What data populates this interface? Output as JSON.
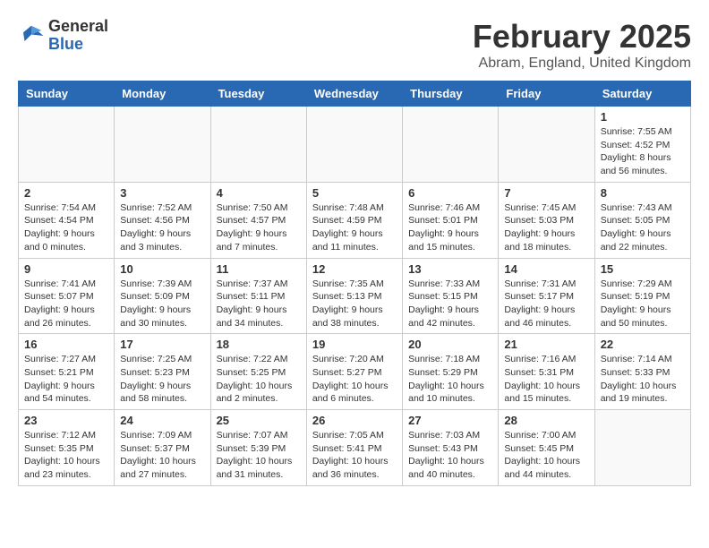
{
  "logo": {
    "line1": "General",
    "line2": "Blue"
  },
  "title": "February 2025",
  "subtitle": "Abram, England, United Kingdom",
  "weekdays": [
    "Sunday",
    "Monday",
    "Tuesday",
    "Wednesday",
    "Thursday",
    "Friday",
    "Saturday"
  ],
  "weeks": [
    [
      {
        "day": "",
        "info": ""
      },
      {
        "day": "",
        "info": ""
      },
      {
        "day": "",
        "info": ""
      },
      {
        "day": "",
        "info": ""
      },
      {
        "day": "",
        "info": ""
      },
      {
        "day": "",
        "info": ""
      },
      {
        "day": "1",
        "info": "Sunrise: 7:55 AM\nSunset: 4:52 PM\nDaylight: 8 hours and 56 minutes."
      }
    ],
    [
      {
        "day": "2",
        "info": "Sunrise: 7:54 AM\nSunset: 4:54 PM\nDaylight: 9 hours and 0 minutes."
      },
      {
        "day": "3",
        "info": "Sunrise: 7:52 AM\nSunset: 4:56 PM\nDaylight: 9 hours and 3 minutes."
      },
      {
        "day": "4",
        "info": "Sunrise: 7:50 AM\nSunset: 4:57 PM\nDaylight: 9 hours and 7 minutes."
      },
      {
        "day": "5",
        "info": "Sunrise: 7:48 AM\nSunset: 4:59 PM\nDaylight: 9 hours and 11 minutes."
      },
      {
        "day": "6",
        "info": "Sunrise: 7:46 AM\nSunset: 5:01 PM\nDaylight: 9 hours and 15 minutes."
      },
      {
        "day": "7",
        "info": "Sunrise: 7:45 AM\nSunset: 5:03 PM\nDaylight: 9 hours and 18 minutes."
      },
      {
        "day": "8",
        "info": "Sunrise: 7:43 AM\nSunset: 5:05 PM\nDaylight: 9 hours and 22 minutes."
      }
    ],
    [
      {
        "day": "9",
        "info": "Sunrise: 7:41 AM\nSunset: 5:07 PM\nDaylight: 9 hours and 26 minutes."
      },
      {
        "day": "10",
        "info": "Sunrise: 7:39 AM\nSunset: 5:09 PM\nDaylight: 9 hours and 30 minutes."
      },
      {
        "day": "11",
        "info": "Sunrise: 7:37 AM\nSunset: 5:11 PM\nDaylight: 9 hours and 34 minutes."
      },
      {
        "day": "12",
        "info": "Sunrise: 7:35 AM\nSunset: 5:13 PM\nDaylight: 9 hours and 38 minutes."
      },
      {
        "day": "13",
        "info": "Sunrise: 7:33 AM\nSunset: 5:15 PM\nDaylight: 9 hours and 42 minutes."
      },
      {
        "day": "14",
        "info": "Sunrise: 7:31 AM\nSunset: 5:17 PM\nDaylight: 9 hours and 46 minutes."
      },
      {
        "day": "15",
        "info": "Sunrise: 7:29 AM\nSunset: 5:19 PM\nDaylight: 9 hours and 50 minutes."
      }
    ],
    [
      {
        "day": "16",
        "info": "Sunrise: 7:27 AM\nSunset: 5:21 PM\nDaylight: 9 hours and 54 minutes."
      },
      {
        "day": "17",
        "info": "Sunrise: 7:25 AM\nSunset: 5:23 PM\nDaylight: 9 hours and 58 minutes."
      },
      {
        "day": "18",
        "info": "Sunrise: 7:22 AM\nSunset: 5:25 PM\nDaylight: 10 hours and 2 minutes."
      },
      {
        "day": "19",
        "info": "Sunrise: 7:20 AM\nSunset: 5:27 PM\nDaylight: 10 hours and 6 minutes."
      },
      {
        "day": "20",
        "info": "Sunrise: 7:18 AM\nSunset: 5:29 PM\nDaylight: 10 hours and 10 minutes."
      },
      {
        "day": "21",
        "info": "Sunrise: 7:16 AM\nSunset: 5:31 PM\nDaylight: 10 hours and 15 minutes."
      },
      {
        "day": "22",
        "info": "Sunrise: 7:14 AM\nSunset: 5:33 PM\nDaylight: 10 hours and 19 minutes."
      }
    ],
    [
      {
        "day": "23",
        "info": "Sunrise: 7:12 AM\nSunset: 5:35 PM\nDaylight: 10 hours and 23 minutes."
      },
      {
        "day": "24",
        "info": "Sunrise: 7:09 AM\nSunset: 5:37 PM\nDaylight: 10 hours and 27 minutes."
      },
      {
        "day": "25",
        "info": "Sunrise: 7:07 AM\nSunset: 5:39 PM\nDaylight: 10 hours and 31 minutes."
      },
      {
        "day": "26",
        "info": "Sunrise: 7:05 AM\nSunset: 5:41 PM\nDaylight: 10 hours and 36 minutes."
      },
      {
        "day": "27",
        "info": "Sunrise: 7:03 AM\nSunset: 5:43 PM\nDaylight: 10 hours and 40 minutes."
      },
      {
        "day": "28",
        "info": "Sunrise: 7:00 AM\nSunset: 5:45 PM\nDaylight: 10 hours and 44 minutes."
      },
      {
        "day": "",
        "info": ""
      }
    ]
  ]
}
